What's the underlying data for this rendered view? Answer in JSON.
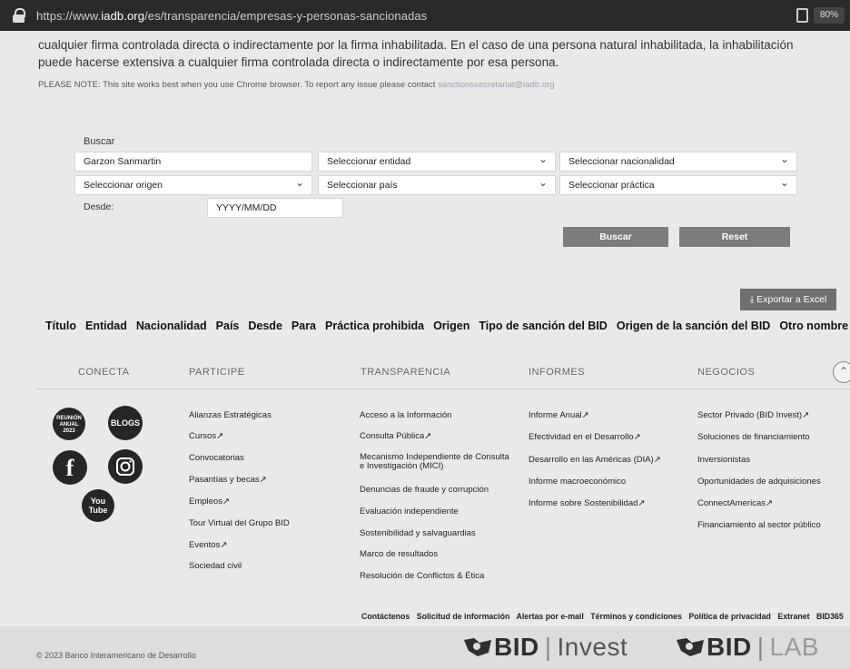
{
  "browser": {
    "url_prefix": "https://www.",
    "url_domain": "iadb.org",
    "url_path": "/es/transparencia/empresas-y-personas-sancionadas",
    "zoom": "80%"
  },
  "intro": {
    "line1": "cualquier firma controlada directa o indirectamente por la firma inhabilitada. En el caso de una persona natural inhabilitada, la inhabilitación",
    "line2": "puede hacerse extensiva a cualquier firma controlada directa o indirectamente por esa persona.",
    "note": "PLEASE NOTE: This site works best when you use Chrome browser. To report any issue please contact",
    "note_email": "sanctionssecretariat@iadb.org"
  },
  "search": {
    "label": "Buscar",
    "query_value": "Garzon Sanmartin",
    "entity": "Seleccionar entidad",
    "nationality": "Seleccionar nacionalidad",
    "origin": "Seleccionar origen",
    "country": "Seleccionar país",
    "practice": "Seleccionar práctica",
    "desde_label": "Desde:",
    "date_placeholder": "YYYY/MM/DD",
    "search_button": "Buscar",
    "reset_button": "Reset",
    "export_button": "Exportar a Excel"
  },
  "table": {
    "columns": [
      "Título",
      "Entidad",
      "Nacionalidad",
      "País",
      "Desde",
      "Para",
      "Práctica prohibida",
      "Origen",
      "Tipo de sanción del BID",
      "Origen de la sanción del BID",
      "Otro nombre"
    ]
  },
  "footer": {
    "headings": {
      "conecta": "CONECTA",
      "participe": "PARTICIPE",
      "transparencia": "TRANSPARENCIA",
      "informes": "INFORMES",
      "negocios": "NEGOCIOS"
    },
    "social": {
      "reunion_l1": "REUNIÓN",
      "reunion_l2": "ANUAL",
      "reunion_l3": "2023",
      "blogs": "BLOGS",
      "facebook": "f",
      "youtube_l1": "You",
      "youtube_l2": "Tube"
    },
    "participe": [
      "Alianzas Estratégicas",
      "Cursos↗",
      "Convocatorias",
      "Pasantías y becas↗",
      "Empleos↗",
      "Tour Virtual del Grupo BID",
      "Eventos↗",
      "Sociedad civil"
    ],
    "transparencia": [
      "Acceso a la Información",
      "Consulta Pública↗",
      "Mecanismo Independiente de Consulta",
      "e Investigación (MICI)",
      "Denuncias de fraude y corrupción",
      "Evaluación independiente",
      "Sostenibilidad y salvaguardias",
      "Marco de resultados",
      "Resolución de Conflictos & Ética"
    ],
    "informes": [
      "Informe Anual↗",
      "Efectividad en el Desarrollo↗",
      "Desarrollo en las Américas (DIA)↗",
      "Informe macroeconómico",
      "Informe sobre Sostenibilidad↗"
    ],
    "negocios": [
      "Sector Privado (BID Invest)↗",
      "Soluciones de financiamiento",
      "Inversionistas",
      "Oportunidades de adquisiciones",
      "ConnectAmericas↗",
      "Financiamiento al sector público"
    ],
    "bottom_links": [
      "Contáctenos",
      "Solicitud de información",
      "Alertas por e-mail",
      "Términos y condiciones",
      "Política de privacidad",
      "Extranet",
      "BID365"
    ],
    "copyright": "© 2023 Banco Interamericano de Desarrollo",
    "logo_invest_a": "BID",
    "logo_invest_b": "Invest",
    "logo_lab_a": "BID",
    "logo_lab_b": "LAB"
  }
}
